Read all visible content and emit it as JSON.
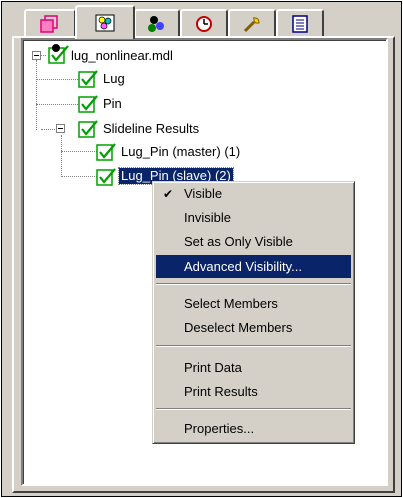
{
  "tabs": [
    {
      "name": "tab-model",
      "icon": "model-cube-icon"
    },
    {
      "name": "tab-visibility",
      "icon": "visibility-palette-icon"
    },
    {
      "name": "tab-groups",
      "icon": "groups-icon"
    },
    {
      "name": "tab-time",
      "icon": "clock-icon"
    },
    {
      "name": "tab-tools",
      "icon": "wrench-icon"
    },
    {
      "name": "tab-list",
      "icon": "list-document-icon"
    }
  ],
  "tree": {
    "root": "lug_nonlinear.mdl",
    "lug": "Lug",
    "pin": "Pin",
    "slideline": "Slideline Results",
    "lug_pin_master": "Lug_Pin (master) (1)",
    "lug_pin_slave": "Lug_Pin (slave) (2)"
  },
  "context_menu": {
    "visible": "Visible",
    "invisible": "Invisible",
    "set_only_visible": "Set as Only Visible",
    "advanced_visibility": "Advanced Visibility...",
    "select_members": "Select Members",
    "deselect_members": "Deselect Members",
    "print_data": "Print Data",
    "print_results": "Print Results",
    "properties": "Properties..."
  },
  "colors": {
    "checkbox_green": "#00a000",
    "selection": "#0a246a",
    "face": "#d4d0c8"
  }
}
